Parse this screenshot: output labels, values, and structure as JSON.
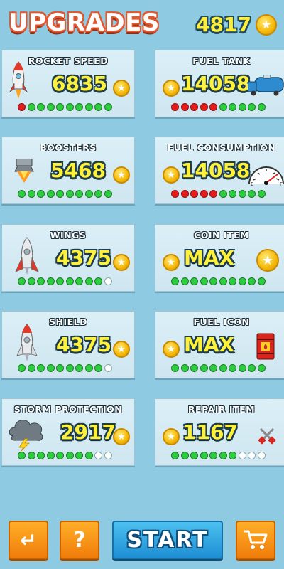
{
  "header": {
    "title": "UPGRADES",
    "total_coins": "4817"
  },
  "cards": [
    {
      "id": "rocket-speed",
      "name": "ROCKET SPEED",
      "price": "6835",
      "icon": "rocket-icon",
      "level": [
        "r",
        "g",
        "g",
        "g",
        "g",
        "g",
        "g",
        "g",
        "g",
        "g"
      ]
    },
    {
      "id": "fuel-tank",
      "name": "FUEL TANK",
      "price": "14058",
      "icon": "fuel-truck-icon",
      "level": [
        "r",
        "r",
        "r",
        "r",
        "r",
        "g",
        "g",
        "g",
        "g",
        "g"
      ]
    },
    {
      "id": "boosters",
      "name": "BOOSTERS",
      "price": "5468",
      "icon": "booster-icon",
      "level": [
        "g",
        "g",
        "g",
        "g",
        "g",
        "g",
        "g",
        "g",
        "g",
        "g"
      ]
    },
    {
      "id": "fuel-consumption",
      "name": "FUEL CONSUMPTION",
      "price": "14058",
      "icon": "fuel-gauge-icon",
      "level": [
        "r",
        "r",
        "r",
        "r",
        "r",
        "g",
        "g",
        "g",
        "g",
        "g"
      ]
    },
    {
      "id": "wings",
      "name": "WINGS",
      "price": "4375",
      "icon": "winged-rocket-icon",
      "level": [
        "g",
        "g",
        "g",
        "g",
        "g",
        "g",
        "g",
        "g",
        "g",
        "e"
      ]
    },
    {
      "id": "coin-item",
      "name": "COIN ITEM",
      "price": "MAX",
      "icon": "coin-icon",
      "level": [
        "g",
        "g",
        "g",
        "g",
        "g",
        "g",
        "g",
        "g",
        "g",
        "g"
      ]
    },
    {
      "id": "shield",
      "name": "SHIELD",
      "price": "4375",
      "icon": "shield-rocket-icon",
      "level": [
        "g",
        "g",
        "g",
        "g",
        "g",
        "g",
        "g",
        "g",
        "g",
        "e"
      ]
    },
    {
      "id": "fuel-icon",
      "name": "FUEL ICON",
      "price": "MAX",
      "icon": "fuel-barrel-icon",
      "level": [
        "g",
        "g",
        "g",
        "g",
        "g",
        "g",
        "g",
        "g",
        "g",
        "g"
      ]
    },
    {
      "id": "storm-protection",
      "name": "STORM PROTECTION",
      "price": "2917",
      "icon": "storm-cloud-icon",
      "level": [
        "g",
        "g",
        "g",
        "g",
        "g",
        "g",
        "g",
        "g",
        "e",
        "e"
      ]
    },
    {
      "id": "repair-item",
      "name": "REPAIR ITEM",
      "price": "1167",
      "icon": "repair-tools-icon",
      "level": [
        "g",
        "g",
        "g",
        "g",
        "g",
        "g",
        "g",
        "e",
        "e",
        "e"
      ]
    }
  ],
  "buttons": {
    "back": "↵",
    "help": "?",
    "start": "START",
    "shop": "shop-cart-icon"
  },
  "colors": {
    "background": "#8ecbe3",
    "price": "#fff13a",
    "dot_green": "#2ecc40",
    "dot_red": "#e41c1c",
    "button_orange": "#f59a1a",
    "button_blue": "#2aa3e0"
  }
}
